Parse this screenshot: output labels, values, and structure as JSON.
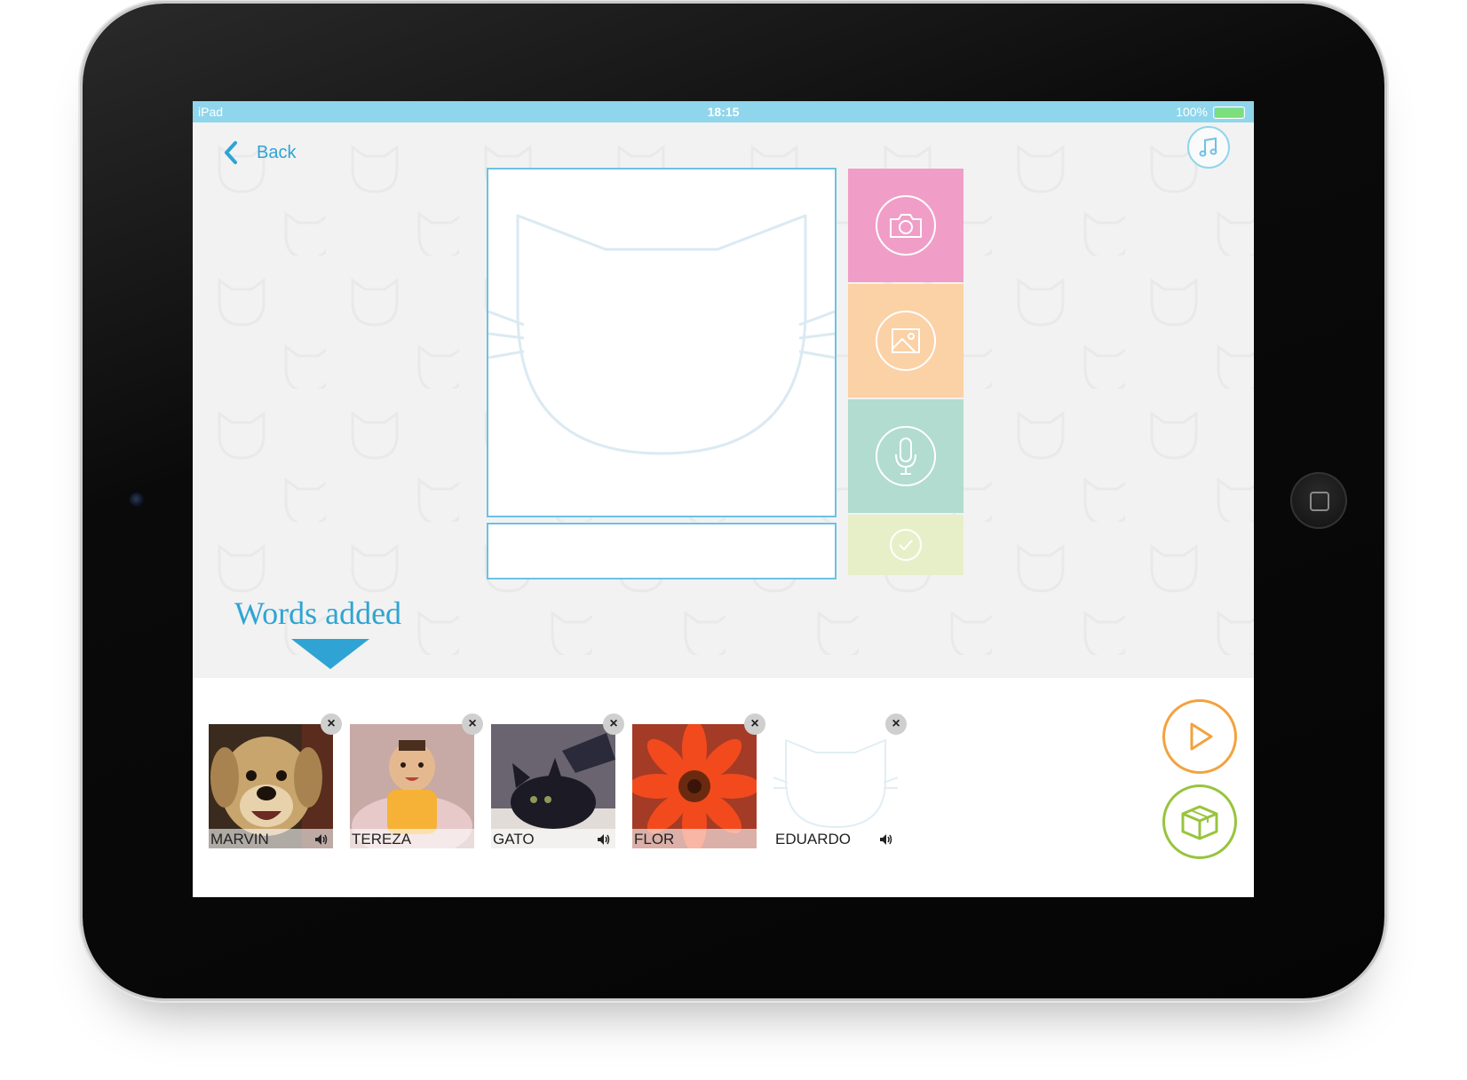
{
  "status_bar": {
    "device": "iPad",
    "time": "18:15",
    "battery": "100%"
  },
  "nav": {
    "back_label": "Back",
    "music_icon": "music-note-icon"
  },
  "editor": {
    "name_value": "",
    "tools": [
      {
        "name": "camera",
        "icon": "camera-icon",
        "color": "#f09ec8"
      },
      {
        "name": "gallery",
        "icon": "image-icon",
        "color": "#fbd1a6"
      },
      {
        "name": "record",
        "icon": "microphone-icon",
        "color": "#b1dccf"
      },
      {
        "name": "confirm",
        "icon": "checkmark-icon",
        "color": "#e7efc8"
      }
    ]
  },
  "words_added": {
    "title": "Words added",
    "items": [
      {
        "label": "MARVIN",
        "image": "dog-photo",
        "has_audio": true
      },
      {
        "label": "TEREZA",
        "image": "baby-photo",
        "has_audio": false
      },
      {
        "label": "GATO",
        "image": "black-cat-photo",
        "has_audio": true
      },
      {
        "label": "FLOR",
        "image": "orange-flower-photo",
        "has_audio": false
      },
      {
        "label": "EDUARDO",
        "image": "cat-placeholder",
        "has_audio": true
      }
    ],
    "remove_symbol": "×"
  },
  "actions": {
    "play_icon": "play-icon",
    "box_icon": "box-icon"
  },
  "colors": {
    "accent": "#2fa4d4",
    "status_bar": "#8fd6ec",
    "play": "#f3a23e",
    "box": "#98c43c"
  }
}
